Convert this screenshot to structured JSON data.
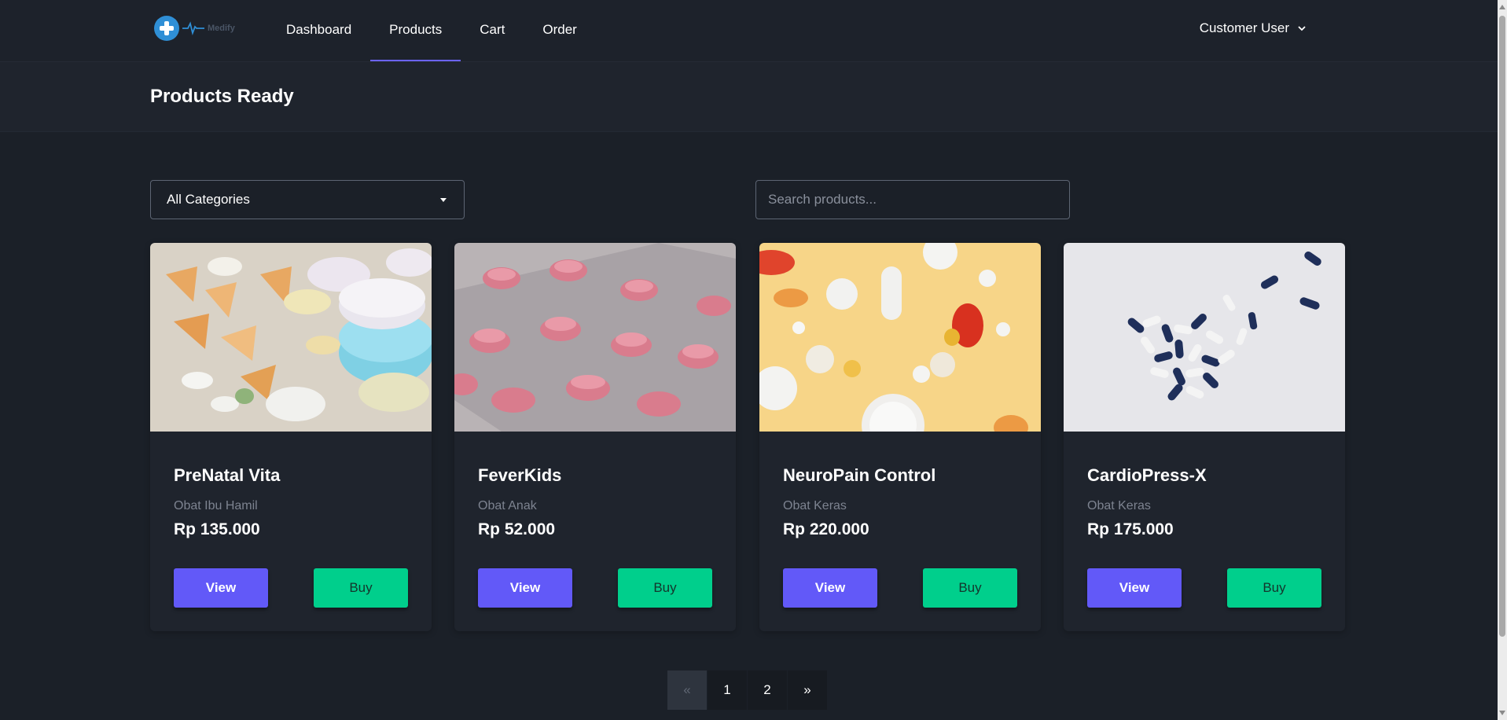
{
  "brand": {
    "logo_text": "Medify",
    "accent_color": "#6c63ff"
  },
  "nav": {
    "items": [
      {
        "label": "Dashboard",
        "active": false
      },
      {
        "label": "Products",
        "active": true
      },
      {
        "label": "Cart",
        "active": false
      },
      {
        "label": "Order",
        "active": false
      }
    ],
    "user_label": "Customer User"
  },
  "page": {
    "title": "Products Ready"
  },
  "filters": {
    "category_selected": "All Categories",
    "search_placeholder": "Search products..."
  },
  "products": [
    {
      "name": "PreNatal Vita",
      "category": "Obat Ibu Hamil",
      "price": "Rp 135.000",
      "view_label": "View",
      "buy_label": "Buy"
    },
    {
      "name": "FeverKids",
      "category": "Obat Anak",
      "price": "Rp 52.000",
      "view_label": "View",
      "buy_label": "Buy"
    },
    {
      "name": "NeuroPain Control",
      "category": "Obat Keras",
      "price": "Rp 220.000",
      "view_label": "View",
      "buy_label": "Buy"
    },
    {
      "name": "CardioPress-X",
      "category": "Obat Keras",
      "price": "Rp 175.000",
      "view_label": "View",
      "buy_label": "Buy"
    }
  ],
  "pagination": {
    "prev": "«",
    "pages": [
      "1",
      "2"
    ],
    "next": "»"
  },
  "colors": {
    "view_button": "#6259f8",
    "buy_button": "#00cf8c",
    "background": "#1b2028"
  }
}
